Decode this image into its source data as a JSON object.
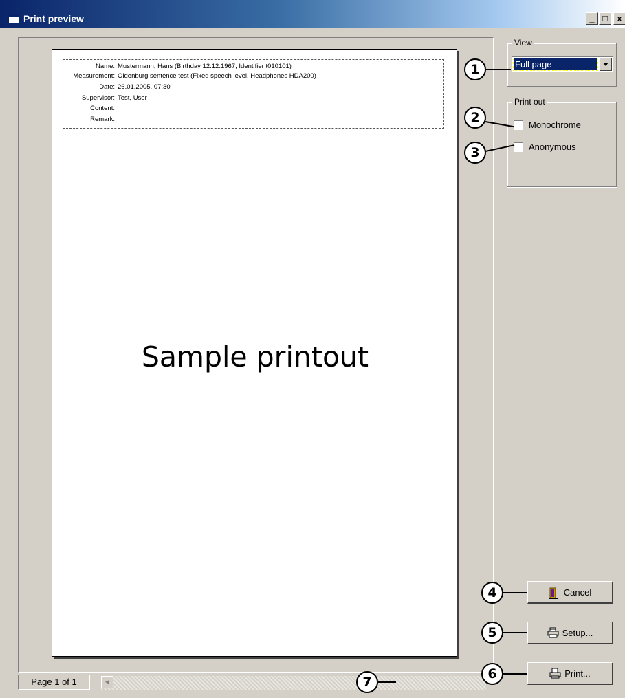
{
  "window": {
    "title": "Print preview",
    "controls": {
      "minimize": "_",
      "maximize": "□",
      "close": "x"
    }
  },
  "preview": {
    "header": [
      {
        "label": "Name:",
        "value": "Mustermann, Hans  (Birthday 12.12.1967, Identifier t010101)"
      },
      {
        "label": "Measurement:",
        "value": "Oldenburg sentence test (Fixed speech level, Headphones HDA200)"
      },
      {
        "label": "Date:",
        "value": "26.01.2005, 07:30"
      },
      {
        "label": "Supervisor:",
        "value": "Test, User"
      },
      {
        "label": "Content:",
        "value": ""
      },
      {
        "label": "Remark:",
        "value": ""
      }
    ],
    "sample_text": "Sample printout"
  },
  "status": {
    "page_indicator": "Page 1 of 1"
  },
  "view_group": {
    "title": "View",
    "selected": "Full page"
  },
  "print_group": {
    "title": "Print out",
    "monochrome": {
      "label": "Monochrome",
      "checked": false
    },
    "anonymous": {
      "label": "Anonymous",
      "checked": false
    }
  },
  "buttons": {
    "cancel": "Cancel",
    "setup": "Setup...",
    "print": "Print..."
  },
  "callouts": [
    "1",
    "2",
    "3",
    "4",
    "5",
    "6",
    "7"
  ],
  "colors": {
    "titlebar": "#0a246a",
    "face": "#d4d0c8",
    "selection": "#0a246a"
  },
  "icons": {
    "cancel": "door-exit-icon",
    "setup": "printer-setup-icon",
    "print": "printer-icon"
  }
}
